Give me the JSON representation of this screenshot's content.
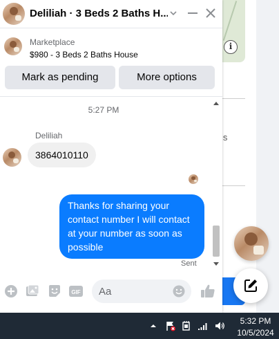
{
  "window": {
    "title": "Deliliah · 3 Beds 2 Baths H..."
  },
  "marketplace": {
    "label": "Marketplace",
    "item": "$980 - 3 Beds 2 Baths House",
    "mark_pending_label": "Mark as pending",
    "more_options_label": "More options"
  },
  "conversation": {
    "timestamp": "5:27 PM",
    "sender_name": "Deliliah",
    "incoming_message": "3864010110",
    "outgoing_message": "Thanks for sharing your contact number I will contact at your number as soon as possible",
    "status": "Sent"
  },
  "composer": {
    "placeholder": "Aa",
    "icons": [
      "plus-circle-icon",
      "photo-icon",
      "sticker-icon",
      "gif-icon",
      "emoji-icon",
      "thumbs-up-icon"
    ],
    "gif_label": "GIF"
  },
  "background": {
    "fragment_text": "is",
    "info_label": "i"
  },
  "taskbar": {
    "time": "5:32 PM",
    "date": "10/5/2024",
    "icons": [
      "chevron-up-icon",
      "flag-alert-icon",
      "network-icon",
      "signal-bars-icon",
      "speaker-icon"
    ]
  },
  "colors": {
    "accent": "#0a7cff",
    "taskbar": "#1f2a36",
    "bubble_in": "#f0f0f0",
    "button_bg": "#e4e6eb"
  }
}
